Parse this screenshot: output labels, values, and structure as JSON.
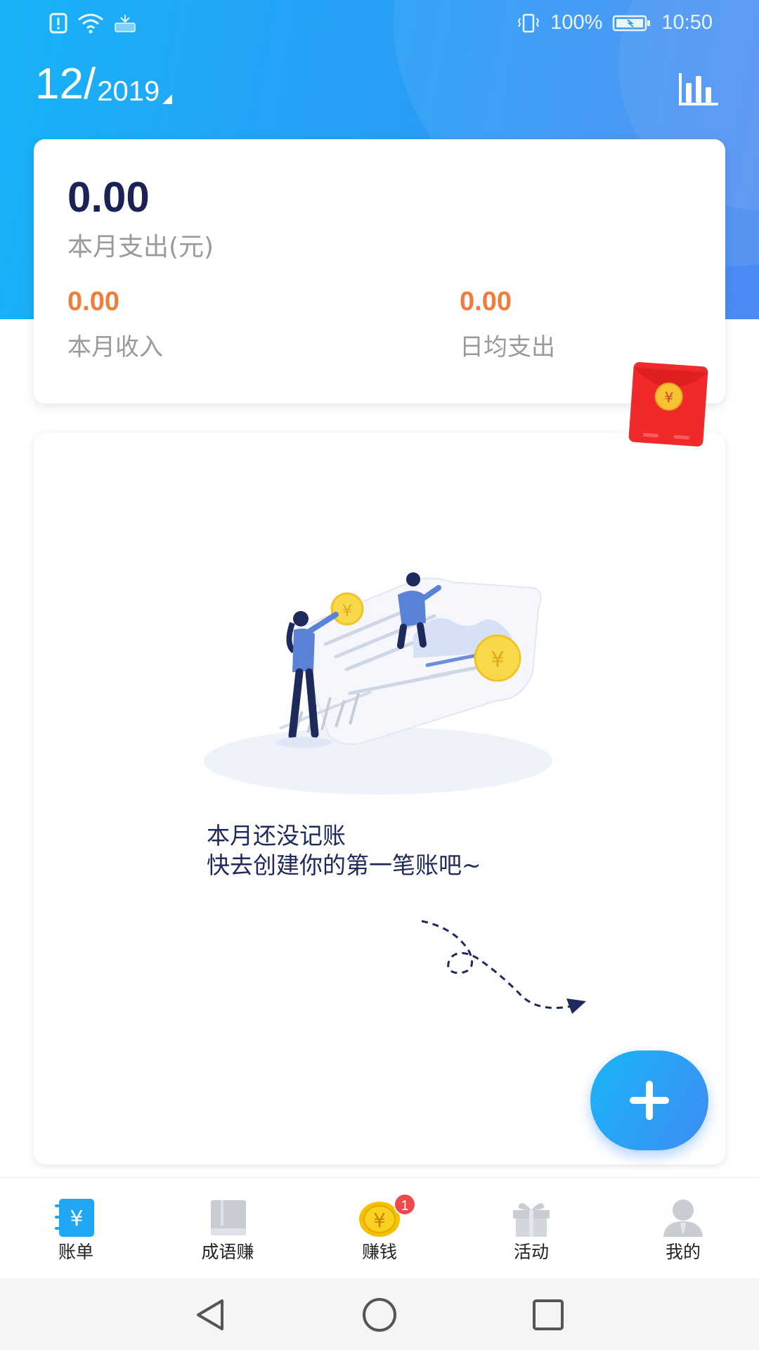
{
  "status_bar": {
    "battery_percent": "100%",
    "time": "10:50"
  },
  "header": {
    "month": "12",
    "slash": "/",
    "year": "2019",
    "stats_icon": "bar-chart-icon"
  },
  "summary": {
    "expense_value": "0.00",
    "expense_label": "本月支出(元)",
    "income_value": "0.00",
    "income_label": "本月收入",
    "daily_avg_value": "0.00",
    "daily_avg_label": "日均支出"
  },
  "empty_state": {
    "line1": "本月还没记账",
    "line2": "快去创建你的第一笔账吧~"
  },
  "fab": {
    "icon": "plus-icon"
  },
  "tabs": [
    {
      "label": "账单",
      "icon": "bill-icon",
      "color": "#1da7f5"
    },
    {
      "label": "成语赚",
      "icon": "book-icon",
      "color": "#c9ccd3"
    },
    {
      "label": "赚钱",
      "icon": "coin-icon",
      "color": "#f6c000",
      "badge": "1"
    },
    {
      "label": "活动",
      "icon": "gift-icon",
      "color": "#c9ccd3"
    },
    {
      "label": "我的",
      "icon": "user-icon",
      "color": "#c9ccd3"
    }
  ],
  "colors": {
    "header_gradient_start": "#17b2f6",
    "header_gradient_end": "#4d8af3",
    "expense_value": "#1b2356",
    "sub_value": "#ef7d3c",
    "red_packet": "#f02a2a"
  }
}
